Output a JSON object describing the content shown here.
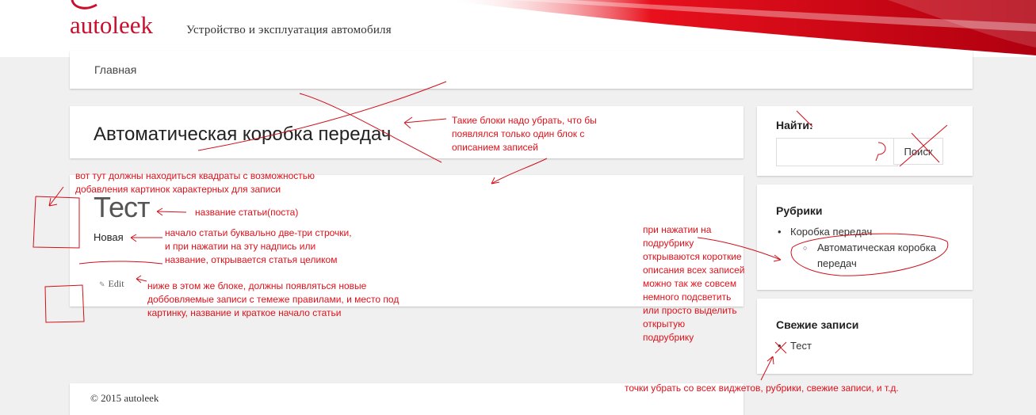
{
  "site": {
    "title": "autoleek",
    "description": "Устройство и эксплуатация автомобиля"
  },
  "nav": {
    "home": "Главная"
  },
  "page": {
    "title": "Автоматическая коробка передач"
  },
  "post": {
    "title": "Тест",
    "excerpt": "Новая",
    "edit": "Edit"
  },
  "sidebar": {
    "search": {
      "title": "Найти:",
      "button": "Поиск",
      "value": ""
    },
    "rubrics": {
      "title": "Рубрики",
      "items": [
        {
          "label": "Коробка передач",
          "children": [
            "Автоматическая коробка передач"
          ]
        }
      ]
    },
    "recent": {
      "title": "Свежие записи",
      "items": [
        "Тест"
      ]
    }
  },
  "footer": {
    "text": "© 2015 autoleek"
  },
  "annotations": {
    "remove_blocks": [
      "Такие блоки надо убрать, что бы",
      "появлялся только один блок с",
      "описанием записей"
    ],
    "squares": [
      "вот тут должны находиться квадраты с возможностью",
      "добавления картинок характерных для записи"
    ],
    "post_title": "название статьи(поста)",
    "excerpt": [
      "начало статьи буквально две-три строчки,",
      "и при нажатии на эту надпись или",
      "название, открывается статья целиком"
    ],
    "new_posts": [
      "ниже в этом же блоке, должны появляться новые",
      "доббовляемые записи с темеже правилами, и место под",
      "картинку, название и краткое начало статьи"
    ],
    "subcategory": [
      "при нажатии на",
      "подрубрику",
      "открываются короткие",
      "описания всех записей",
      "можно так же совсем",
      "немного подсветить",
      "или просто выделить",
      "открытую",
      "подрубрику"
    ],
    "dots": "точки убрать со всех виджетов, рубрики, свежие записи, и т.д."
  },
  "colors": {
    "accent": "#c8102e",
    "annotation": "#e0101a"
  }
}
